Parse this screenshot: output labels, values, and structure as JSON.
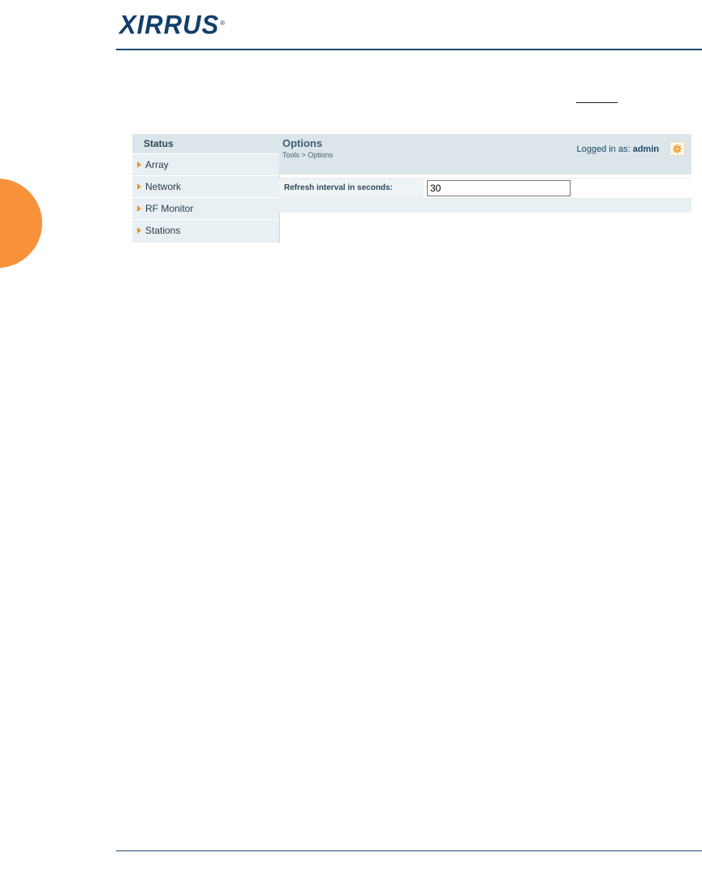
{
  "brand": {
    "logo_text": "XIRRUS",
    "logo_mark": "®"
  },
  "sidebar": {
    "title": "Status",
    "items": [
      {
        "label": "Array"
      },
      {
        "label": "Network"
      },
      {
        "label": "RF Monitor"
      },
      {
        "label": "Stations"
      }
    ]
  },
  "page": {
    "title": "Options",
    "breadcrumb": "Tools > Options",
    "logged_in_label": "Logged in as:",
    "user": "admin"
  },
  "options": {
    "refresh_label": "Refresh interval in seconds:",
    "refresh_value": "30"
  },
  "colors": {
    "brand_navy": "#123f6b",
    "accent_orange": "#f7923a",
    "arrow_orange": "#ef9228",
    "panel_blue": "#dbe5ea"
  }
}
